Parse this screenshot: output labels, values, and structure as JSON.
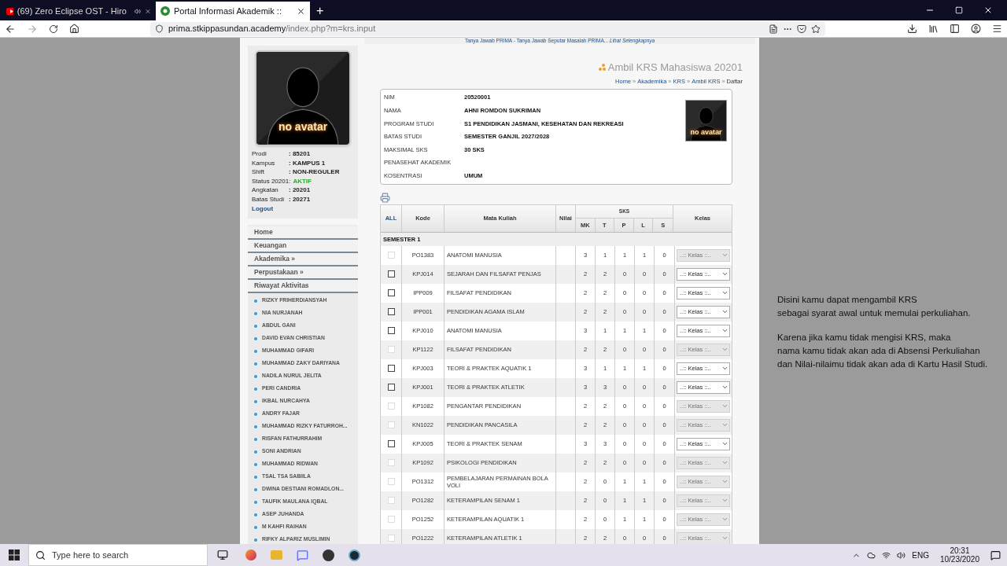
{
  "browser": {
    "tabs": [
      {
        "title": "(69) Zero Eclipse OST - Hiro",
        "kind": "video",
        "selected": false
      },
      {
        "title": "Portal Informasi Akademik ::",
        "kind": "site",
        "selected": true
      }
    ],
    "new_tab": "+",
    "url_host": "prima.stkippasundan.academy",
    "url_path": "/index.php?m=krs.input"
  },
  "sidebar": {
    "avatar_caption": "no avatar",
    "info": [
      {
        "label": "Prodi",
        "value": ": 85201",
        "kind": "plain"
      },
      {
        "label": "Kampus",
        "value": ": KAMPUS 1",
        "kind": "plain"
      },
      {
        "label": "Shift",
        "value": ": NON-REGULER",
        "kind": "plain"
      },
      {
        "label": "Status 20201:",
        "value": "AKTIF",
        "kind": "status"
      },
      {
        "label": "Angkatan",
        "value": ": 20201",
        "kind": "plain"
      },
      {
        "label": "Batas Studi",
        "value": ": 20271",
        "kind": "plain"
      }
    ],
    "logout": "Logout",
    "menu": [
      "Home",
      "Keuangan",
      "Akademika »",
      "Perpustakaan »",
      "Riwayat Aktivitas"
    ],
    "students": [
      "RIZKY FRIHERDIANSYAH",
      "NIA NURJANAH",
      "ABDUL GANI",
      "DAVID EVAN CHRISTIAN",
      "MUHAMMAD GIFARI",
      "MUHAMMAD ZAKY DARIYANA",
      "NADILA NURUL JELITA",
      "PERI CANDRIA",
      "IKBAL NURCAHYA",
      "ANDRY FAJAR",
      "MUHAMMAD RIZKY FATURROH...",
      "RISFAN FATHURRAHIM",
      "SONI ANDRIAN",
      "MUHAMMAD RIDWAN",
      "TSAL TSA SABIILA",
      "DWINA DESTIANI ROMADLON...",
      "TAUFIK MAULANA IQBAL",
      "ASEP JUHANDA",
      "M KAHFI RAIHAN",
      "RIFKY ALPARIZ MUSLIMIN"
    ]
  },
  "banner": {
    "text": "Tanya Jawab PRIMA - Tanya Jawab Seputar Masalah PRIMA...",
    "link": "Lihat Selengkapnya"
  },
  "page_title": "Ambil KRS Mahasiswa 20201",
  "breadcrumb": {
    "links": [
      {
        "text": "Home",
        "separator": "»"
      },
      {
        "text": "Akademika",
        "separator": "»"
      },
      {
        "text": "KRS",
        "separator": "»"
      },
      {
        "text": "Ambil KRS",
        "separator": "»"
      }
    ],
    "current": "Daftar"
  },
  "student_card": {
    "avatar_caption": "no avatar",
    "fields": [
      {
        "label": "NIM",
        "value": "20520001"
      },
      {
        "label": "NAMA",
        "value": "AHNI ROMDON SUKRIMAN"
      },
      {
        "label": "PROGRAM STUDI",
        "value": "S1 PENDIDIKAN JASMANI, KESEHATAN DAN REKREASI"
      },
      {
        "label": "BATAS STUDI",
        "value": "SEMESTER GANJIL 2027/2028"
      },
      {
        "label": "MAKSIMAL SKS",
        "value": "30 SKS"
      },
      {
        "label": "PENASEHAT AKADEMIK"
      },
      {
        "label": "KOSENTRASI",
        "value": "UMUM"
      }
    ]
  },
  "table": {
    "select_all": "ALL",
    "columns": [
      "Kode",
      "Mata Kuliah",
      "Nilai",
      "Kelas"
    ],
    "sks_group": "SKS",
    "sks_columns": [
      "MK",
      "T",
      "P",
      "L",
      "S"
    ],
    "section": "SEMESTER 1",
    "rows": [
      {
        "code": "PO1383",
        "name": "ANATOMI MANUSIA",
        "sks": [
          "3",
          "1",
          "1",
          "1",
          "0"
        ],
        "disabled": true,
        "class_select": "..:: Kelas ::.."
      },
      {
        "code": "KPJ014",
        "name": "SEJARAH DAN FILSAFAT PENJAS",
        "sks": [
          "2",
          "2",
          "0",
          "0",
          "0"
        ],
        "disabled": false,
        "class_select": "..:: Kelas ::.."
      },
      {
        "code": "IPP009",
        "name": "FILSAFAT PENDIDIKAN",
        "sks": [
          "2",
          "2",
          "0",
          "0",
          "0"
        ],
        "disabled": false,
        "class_select": "..:: Kelas ::.."
      },
      {
        "code": "IPP001",
        "name": "PENDIDIKAN AGAMA ISLAM",
        "sks": [
          "2",
          "2",
          "0",
          "0",
          "0"
        ],
        "disabled": false,
        "class_select": "..:: Kelas ::.."
      },
      {
        "code": "KPJ010",
        "name": "ANATOMI MANUSIA",
        "sks": [
          "3",
          "1",
          "1",
          "1",
          "0"
        ],
        "disabled": false,
        "class_select": "..:: Kelas ::.."
      },
      {
        "code": "KP1122",
        "name": "FILSAFAT PENDIDIKAN",
        "sks": [
          "2",
          "2",
          "0",
          "0",
          "0"
        ],
        "disabled": true,
        "class_select": "..:: Kelas ::.."
      },
      {
        "code": "KPJ003",
        "name": "TEORI & PRAKTEK AQUATIK 1",
        "sks": [
          "3",
          "1",
          "1",
          "1",
          "0"
        ],
        "disabled": false,
        "class_select": "..:: Kelas ::.."
      },
      {
        "code": "KPJ001",
        "name": "TEORI & PRAKTEK ATLETIK",
        "sks": [
          "3",
          "3",
          "0",
          "0",
          "0"
        ],
        "disabled": false,
        "class_select": "..:: Kelas ::.."
      },
      {
        "code": "KP1082",
        "name": "PENGANTAR PENDIDIKAN",
        "sks": [
          "2",
          "2",
          "0",
          "0",
          "0"
        ],
        "disabled": true,
        "class_select": "..:: Kelas ::.."
      },
      {
        "code": "KN1022",
        "name": "PENDIDIKAN PANCASILA",
        "sks": [
          "2",
          "2",
          "0",
          "0",
          "0"
        ],
        "disabled": true,
        "class_select": "..:: Kelas ::.."
      },
      {
        "code": "KPJ005",
        "name": "TEORI & PRAKTEK SENAM",
        "sks": [
          "3",
          "3",
          "0",
          "0",
          "0"
        ],
        "disabled": false,
        "class_select": "..:: Kelas ::.."
      },
      {
        "code": "KP1092",
        "name": "PSIKOLOGI PENDIDIKAN",
        "sks": [
          "2",
          "2",
          "0",
          "0",
          "0"
        ],
        "disabled": true,
        "class_select": "..:: Kelas ::.."
      },
      {
        "code": "PO1312",
        "name": "PEMBELAJARAN PERMAINAN BOLA VOLI",
        "sks": [
          "2",
          "0",
          "1",
          "1",
          "0"
        ],
        "disabled": true,
        "class_select": "..:: Kelas ::.."
      },
      {
        "code": "PO1282",
        "name": "KETERAMPILAN SENAM 1",
        "sks": [
          "2",
          "0",
          "1",
          "1",
          "0"
        ],
        "disabled": true,
        "class_select": "..:: Kelas ::.."
      },
      {
        "code": "PO1252",
        "name": "KETERAMPILAN AQUATIK 1",
        "sks": [
          "2",
          "0",
          "1",
          "1",
          "0"
        ],
        "disabled": true,
        "class_select": "..:: Kelas ::.."
      },
      {
        "code": "PO1222",
        "name": "KETERAMPILAN ATLETIK 1",
        "sks": [
          "2",
          "2",
          "0",
          "0",
          "0"
        ],
        "disabled": true,
        "class_select": "..:: Kelas ::.."
      }
    ]
  },
  "overlay_note": {
    "paragraphs": [
      [
        "Disini kamu dapat mengambil KRS",
        "sebagai syarat awal untuk memulai perkuliahan."
      ],
      [
        "Karena jika kamu tidak mengisi KRS, maka",
        "nama kamu tidak akan ada di Absensi Perkuliahan",
        "dan Nilai-nilaimu tidak akan ada di Kartu Hasil Studi."
      ]
    ]
  },
  "taskbar": {
    "search_placeholder": "Type here to search",
    "language": "ENG",
    "time": "20:31",
    "date": "10/23/2020"
  }
}
